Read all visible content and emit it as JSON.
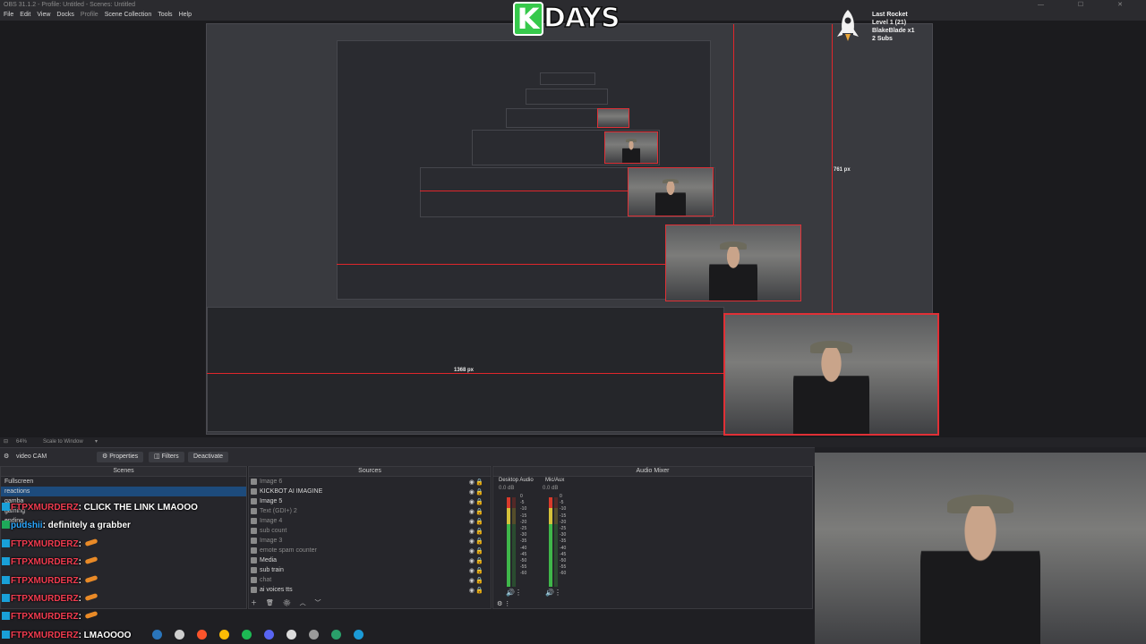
{
  "window": {
    "title": "OBS 31.1.2 - Profile: Untitled - Scenes: Untitled",
    "menu": [
      "File",
      "Edit",
      "View",
      "Docks",
      "Profile",
      "Scene Collection",
      "Tools",
      "Help"
    ],
    "dim_menu_index": 4
  },
  "overlay": {
    "logo_letter": "K",
    "logo_text": "DAYS",
    "alert": {
      "line1": "Last Rocket",
      "line2": "Level 1  (21)",
      "line3": "BlakeBlade x1",
      "line4": "2 Subs"
    }
  },
  "preview": {
    "dim_vertical": "761 px",
    "dim_horizontal": "1368 px"
  },
  "zoom": {
    "percent": "64%",
    "scale_label": "Scale to Window"
  },
  "dock": {
    "scene_name": "video CAM",
    "properties_label": "Properties",
    "filters_label": "Filters",
    "deactivate_label": "Deactivate"
  },
  "scenes": {
    "header": "Scenes",
    "items": [
      "Fullscreen",
      "reactions",
      "gamba",
      "gaming",
      "ending"
    ],
    "selected": 1
  },
  "sources": {
    "header": "Sources",
    "items": [
      {
        "name": "Image 6",
        "dim": true
      },
      {
        "name": "KICKBOT AI IMAGINE",
        "dim": false
      },
      {
        "name": "Image 5",
        "dim": false
      },
      {
        "name": "Text (GDI+) 2",
        "dim": true
      },
      {
        "name": "Image 4",
        "dim": true
      },
      {
        "name": "sub count",
        "dim": true
      },
      {
        "name": "Image 3",
        "dim": true
      },
      {
        "name": "emote spam counter",
        "dim": true
      },
      {
        "name": "Media",
        "dim": false
      },
      {
        "name": "sub train",
        "dim": false
      },
      {
        "name": "chat",
        "dim": true
      },
      {
        "name": "ai voices tts",
        "dim": false
      }
    ]
  },
  "mixer": {
    "header": "Audio Mixer",
    "channels": [
      {
        "name": "Desktop Audio",
        "level": "0.0 dB"
      },
      {
        "name": "Mic/Aux",
        "level": "0.0 dB"
      }
    ],
    "ticks": [
      "0",
      "-5",
      "-10",
      "-15",
      "-20",
      "-25",
      "-30",
      "-35",
      "-40",
      "-45",
      "-50",
      "-55",
      "-60"
    ]
  },
  "chat": [
    {
      "user": "FTPXMURDERZ",
      "msg": ": CLICK THE LINK LMAOOO",
      "carrot": false,
      "c": 1,
      "badge": "b"
    },
    {
      "user": "pudshii",
      "msg": ": definitely a grabber",
      "carrot": false,
      "c": 2,
      "badge": "g"
    },
    {
      "user": "FTPXMURDERZ",
      "msg": ":",
      "carrot": true,
      "c": 1,
      "badge": "b"
    },
    {
      "user": "FTPXMURDERZ",
      "msg": ":",
      "carrot": true,
      "c": 1,
      "badge": "b"
    },
    {
      "user": "FTPXMURDERZ",
      "msg": ":",
      "carrot": true,
      "c": 1,
      "badge": "b"
    },
    {
      "user": "FTPXMURDERZ",
      "msg": ":",
      "carrot": true,
      "c": 1,
      "badge": "b"
    },
    {
      "user": "FTPXMURDERZ",
      "msg": ":",
      "carrot": true,
      "c": 1,
      "badge": "b"
    },
    {
      "user": "FTPXMURDERZ",
      "msg": ": LMAOOOO",
      "carrot": false,
      "c": 1,
      "badge": "b"
    }
  ],
  "taskbar": {
    "icons": [
      "steam-icon",
      "settings-icon",
      "brave-icon",
      "chrome-icon",
      "spotify-icon",
      "discord-icon",
      "notes-icon",
      "obs-icon",
      "terminal-icon",
      "steam2-icon"
    ],
    "colors": [
      "#2a75bb",
      "#cfcfcf",
      "#fb542b",
      "#fbbc05",
      "#1db954",
      "#5865f2",
      "#dcdcdc",
      "#9a9a9a",
      "#2aa06a",
      "#1b9ad6"
    ]
  }
}
